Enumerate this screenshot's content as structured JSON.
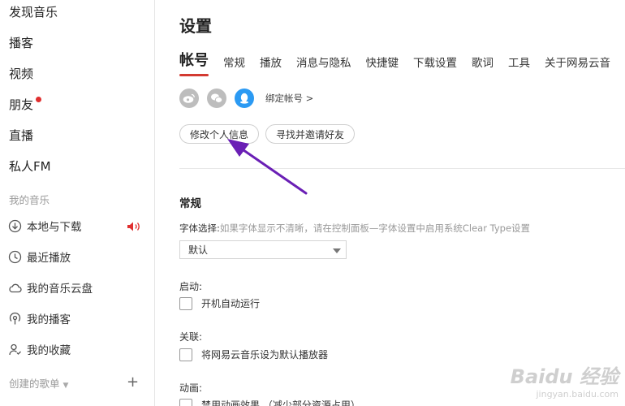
{
  "sidebar": {
    "nav": [
      "发现音乐",
      "播客",
      "视频",
      "朋友",
      "直播",
      "私人FM"
    ],
    "my_music_title": "我的音乐",
    "my_items": [
      "本地与下载",
      "最近播放",
      "我的音乐云盘",
      "我的播客",
      "我的收藏"
    ],
    "created_title": "创建的歌单",
    "plus": "+"
  },
  "settings": {
    "title": "设置",
    "tabs": [
      "帐号",
      "常规",
      "播放",
      "消息与隐私",
      "快捷键",
      "下载设置",
      "歌词",
      "工具",
      "关于网易云音"
    ],
    "bind_label": "绑定帐号 >",
    "edit_profile": "修改个人信息",
    "find_friends": "寻找并邀请好友",
    "general_title": "常规",
    "font_label": "字体选择:",
    "font_hint": "如果字体显示不清晰，请在控制面板—字体设置中启用系统Clear Type设置",
    "font_value": "默认",
    "startup_label": "启动:",
    "startup_option": "开机自动运行",
    "assoc_label": "关联:",
    "assoc_option": "将网易云音乐设为默认播放器",
    "anim_label": "动画:",
    "anim_option": "禁用动画效果 （减少部分资源占用）"
  },
  "watermark": {
    "brand": "Baidu 经验",
    "url": "jingyan.baidu.com"
  },
  "colors": {
    "accent": "#d33a31",
    "arrow": "#6a1fb5",
    "qq": "#2b9af3"
  }
}
